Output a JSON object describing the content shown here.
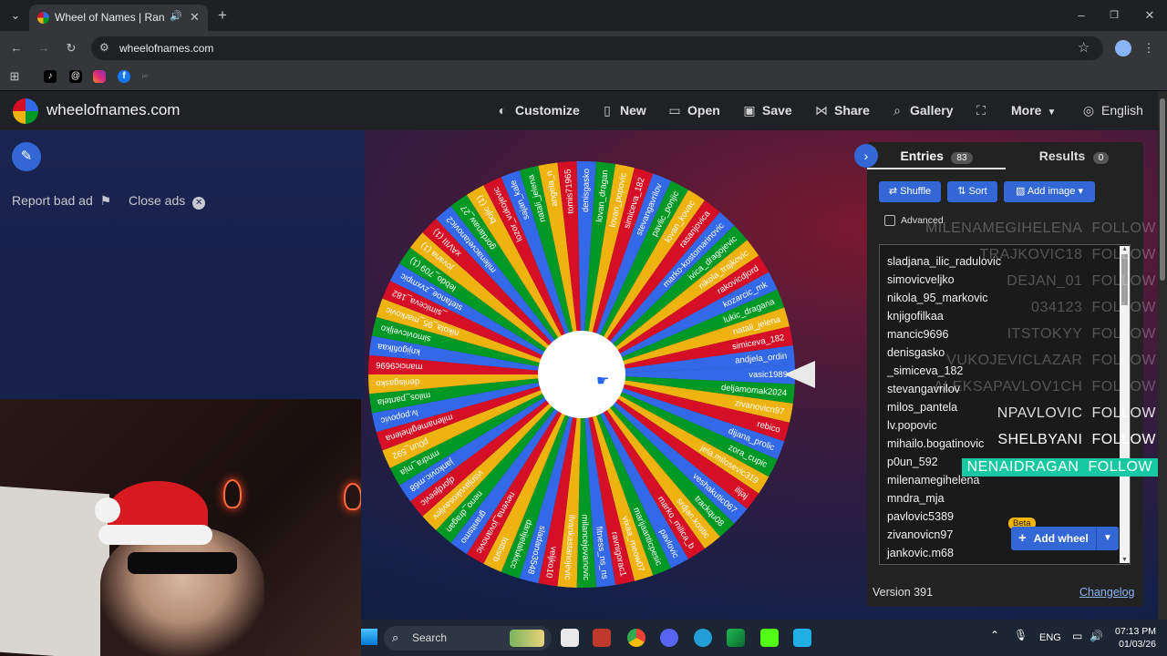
{
  "browser": {
    "tab_title": "Wheel of Names | Random",
    "url": "wheelofnames.com"
  },
  "header": {
    "logo_text": "wheelofnames.com",
    "nav": [
      {
        "label": "Customize",
        "icon": "palette-icon"
      },
      {
        "label": "New",
        "icon": "file-icon"
      },
      {
        "label": "Open",
        "icon": "folder-icon"
      },
      {
        "label": "Save",
        "icon": "save-icon"
      },
      {
        "label": "Share",
        "icon": "share-icon"
      },
      {
        "label": "Gallery",
        "icon": "search-icon"
      },
      {
        "label": "More",
        "icon": "chevron-down-icon"
      },
      {
        "label": "English",
        "icon": "globe-icon"
      }
    ]
  },
  "left": {
    "report_label": "Report bad ad",
    "close_label": "Close ads"
  },
  "wheel": {
    "colors": [
      "#3369e8",
      "#009925",
      "#eeb211",
      "#d50f25"
    ],
    "labels": [
      "vasic1989",
      "deljamomak2024",
      "zivanovicn97",
      "rebico",
      "dijana_prolic",
      "zora_cupic",
      "jela.milosevic319",
      "ilijaj",
      "veshakutic067",
      "trackqu08",
      "srdjan.kostic",
      "marko_milica_b",
      "pavlovic",
      "marijaanticpesic",
      "vixaa_meow07",
      "ravnigorac1",
      "fitness_ns_ns",
      "milancejovanovic",
      "ilvankastanojevic",
      "veljko10",
      "sladano3548",
      "danijelalukicc",
      "tottisrb",
      "nevena_jovanovic",
      "granitsmo",
      "neno_dragan",
      "visnjavukosavljev",
      "djordjeevic",
      "jankovic.m68",
      "mndra_mja",
      "p0un_592",
      "milenamegihelena",
      "lv.popovic",
      "milos_pantela",
      "denisgasko",
      "mancic9696",
      "knjigofilkaa",
      "simovicveljko",
      "nikola_95_markovic",
      "_simiceva_182",
      "stefanoe_zvxmpic",
      "lebdo_709 (1)",
      "jovana (1)",
      "xAVIII (1)",
      "milenacvetanovic2",
      "gordanaw_27",
      "bojic (1)",
      "lozor_vukojevic",
      "sajan_kale",
      "natali_jelena",
      "angela_n",
      "tomis71965",
      "denisgasko",
      "lovan_dragan",
      "lovan_popovic",
      "simiceva_182",
      "stevangavrilov",
      "pavlic_ponjic",
      "lovan_kovac",
      "rasanjovica",
      "marko-kostomarinovic",
      "ivica_dragojevic",
      "nikola_trajkovic",
      "rakovicdjord",
      "kozarcic_mk",
      "lukic_dragana",
      "natali_jelena",
      "simiceva_182",
      "andjela_ordin"
    ]
  },
  "entries_panel": {
    "tab_entries": "Entries",
    "entries_count": "83",
    "tab_results": "Results",
    "results_count": "0",
    "shuffle": "Shuffle",
    "sort": "Sort",
    "add_image": "Add image",
    "advanced": "Advanced",
    "entries": [
      "sladjana_ilic_radulovic",
      "simovicveljko",
      "nikola_95_markovic",
      "knjigofilkaa",
      "mancic9696",
      "denisgasko",
      "_simiceva_182",
      "stevangavrilov",
      "milos_pantela",
      "lv.popovic",
      "mihailo.bogatinovic",
      "p0un_592",
      "milenamegihelena",
      "mndra_mja",
      "pavlovic5389",
      "zivanovicn97",
      "jankovic.m68"
    ],
    "beta": "Beta",
    "add_wheel": "Add wheel",
    "version": "Version 391",
    "changelog": "Changelog"
  },
  "overlay": [
    {
      "name": "MILENAMEGIHELENA",
      "action": "FOLLOW"
    },
    {
      "name": "TRAJKOVIC18",
      "action": "FOLLOW"
    },
    {
      "name": "DEJAN_01",
      "action": "FOLLOW"
    },
    {
      "name": "034123",
      "action": "FOLLOW"
    },
    {
      "name": "ITSTOKYY",
      "action": "FOLLOW"
    },
    {
      "name": "VUKOJEVICLAZAR",
      "action": "FOLLOW"
    },
    {
      "name": "ALEKSAPAVLOV1CH",
      "action": "FOLLOW"
    },
    {
      "name": "NPAVLOVIC",
      "action": "FOLLOW"
    },
    {
      "name": "SHELBYANI",
      "action": "FOLLOW"
    },
    {
      "name": "NENAIDRAGAN",
      "action": "FOLLOW"
    }
  ],
  "taskbar": {
    "search": "Search",
    "lang": "ENG",
    "time": "07:13 PM",
    "date": "01/03/26"
  }
}
